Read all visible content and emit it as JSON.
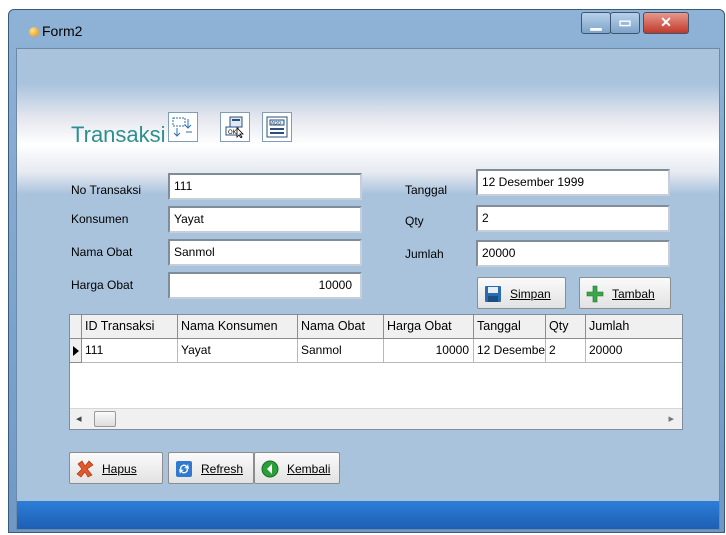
{
  "window": {
    "title": "Form2",
    "min_glyph": "▁",
    "max_glyph": "▭",
    "close_glyph": "✕"
  },
  "form": {
    "title": "Transaksi",
    "toolbar_icons": [
      "grid-sort-icon",
      "database-connect-icon",
      "ado-control-icon"
    ]
  },
  "fields": {
    "no_transaksi": {
      "label": "No Transaksi",
      "value": "111"
    },
    "konsumen": {
      "label": "Konsumen",
      "value": "Yayat"
    },
    "nama_obat": {
      "label": "Nama Obat",
      "value": "Sanmol"
    },
    "harga_obat": {
      "label": "Harga Obat",
      "value": "10000"
    },
    "tanggal": {
      "label": "Tanggal",
      "value": "12 Desember 1999"
    },
    "qty": {
      "label": "Qty",
      "value": "2"
    },
    "jumlah": {
      "label": "Jumlah",
      "value": "20000"
    }
  },
  "buttons": {
    "simpan": "Simpan",
    "tambah": "Tambah",
    "hapus": "Hapus",
    "refresh": "Refresh",
    "kembali": "Kembali"
  },
  "grid": {
    "columns": [
      "ID Transaksi",
      "Nama Konsumen",
      "Nama Obat",
      "Harga Obat",
      "Tanggal",
      "Qty",
      "Jumlah"
    ],
    "rows": [
      [
        "111",
        "Yayat",
        "Sanmol",
        "10000",
        "12 Desembe",
        "2",
        "20000"
      ]
    ]
  },
  "colors": {
    "title_teal": "#2f8f8f",
    "status_blue": "#1e5fb4",
    "close_red": "#c0392b"
  }
}
